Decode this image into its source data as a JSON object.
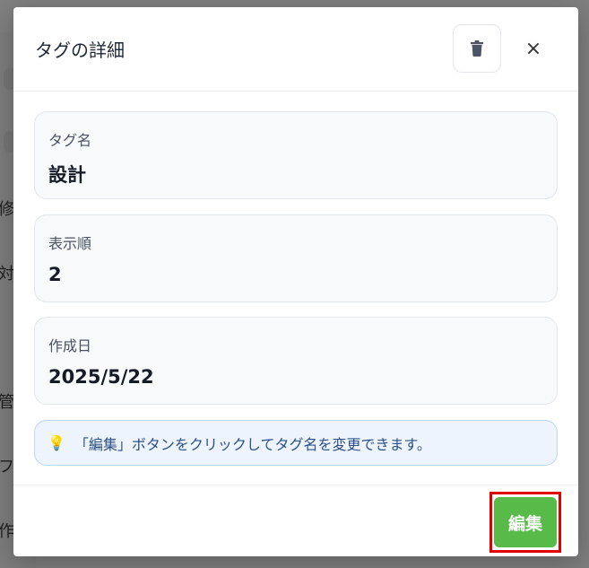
{
  "background": {
    "chars": [
      "修",
      "対",
      "管",
      "フ",
      "作"
    ]
  },
  "modal": {
    "title": "タグの詳細",
    "delete_icon": "trash-icon",
    "close_label": "×",
    "fields": [
      {
        "label": "タグ名",
        "value": "設計"
      },
      {
        "label": "表示順",
        "value": "2"
      },
      {
        "label": "作成日",
        "value": "2025/5/22"
      }
    ],
    "hint": {
      "icon": "💡",
      "text": "「編集」ボタンをクリックしてタグ名を変更できます。"
    },
    "edit_button": "編集"
  },
  "colors": {
    "accent_green": "#58ba49",
    "hint_bg": "#edf4fe",
    "highlight_red": "#e10000"
  }
}
